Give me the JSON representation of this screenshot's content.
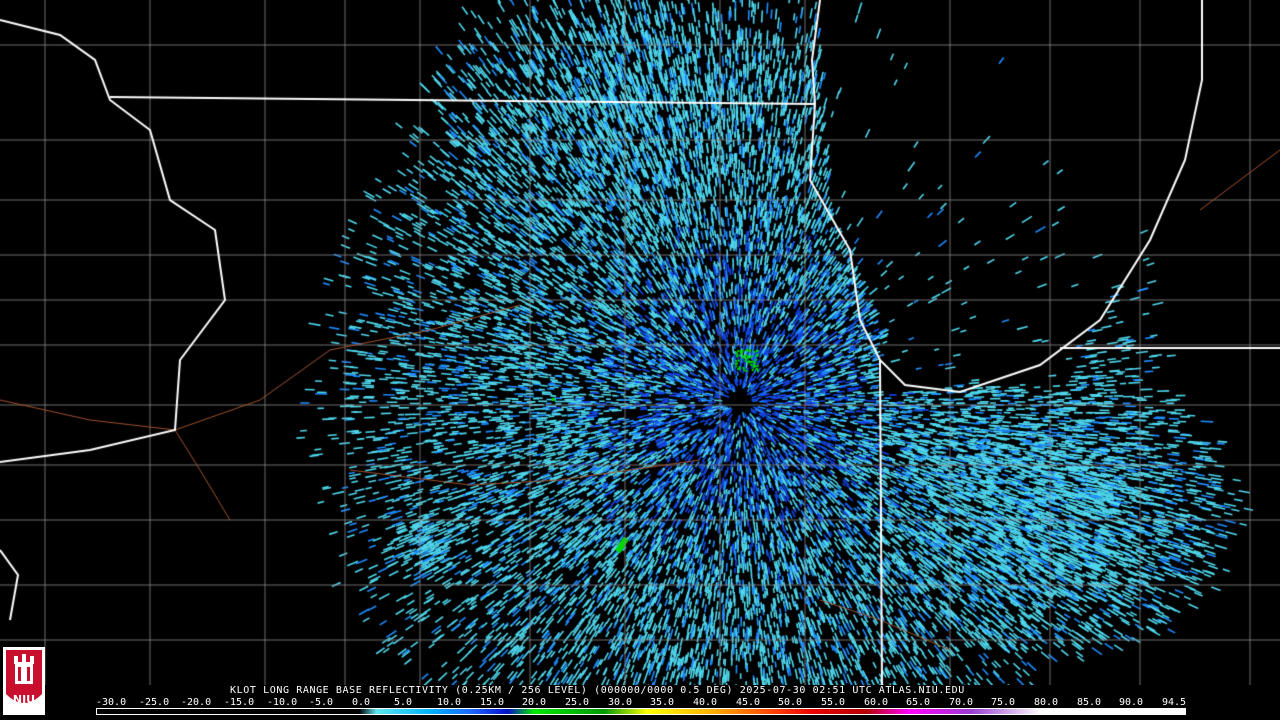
{
  "product_caption": "KLOT LONG RANGE BASE REFLECTIVITY (0.25KM / 256 LEVEL) (000000/0000 0.5 DEG) 2025-07-30 02:51 UTC  ATLAS.NIU.EDU",
  "scale": {
    "labels": [
      "-30.0",
      "-25.0",
      "-20.0",
      "-15.0",
      "-10.0",
      "-5.0",
      "0.0",
      "5.0",
      "10.0",
      "15.0",
      "20.0",
      "25.0",
      "30.0",
      "35.0",
      "40.0",
      "45.0",
      "50.0",
      "55.0",
      "60.0",
      "65.0",
      "70.0",
      "75.0",
      "80.0",
      "85.0",
      "90.0",
      "94.5"
    ],
    "stops": [
      {
        "value": -30,
        "color": "#000000"
      },
      {
        "value": 0,
        "color": "#000000"
      },
      {
        "value": 2,
        "color": "#5ee6ee"
      },
      {
        "value": 8,
        "color": "#00b4ff"
      },
      {
        "value": 13,
        "color": "#1e64ff"
      },
      {
        "value": 17,
        "color": "#0010c8"
      },
      {
        "value": 20,
        "color": "#00e800"
      },
      {
        "value": 28,
        "color": "#009a00"
      },
      {
        "value": 33,
        "color": "#ffff00"
      },
      {
        "value": 40,
        "color": "#ffb400"
      },
      {
        "value": 47,
        "color": "#ff4800"
      },
      {
        "value": 52,
        "color": "#e80000"
      },
      {
        "value": 58,
        "color": "#b40000"
      },
      {
        "value": 63,
        "color": "#ff00ff"
      },
      {
        "value": 70,
        "color": "#9a3cd0"
      },
      {
        "value": 78,
        "color": "#ffffff"
      },
      {
        "value": 94.5,
        "color": "#ffffff"
      }
    ]
  },
  "logo": {
    "text": "NIU",
    "color": "#c8102e"
  },
  "colors": {
    "background": "#000000",
    "state_border": "#ffffff",
    "county_border": "#8c8c8c",
    "river": "#a0522d",
    "echo_light": "#4fd8ee",
    "echo_mid": "#1e8cff",
    "echo_strong": "#1446e6",
    "echo_green": "#00d800"
  }
}
